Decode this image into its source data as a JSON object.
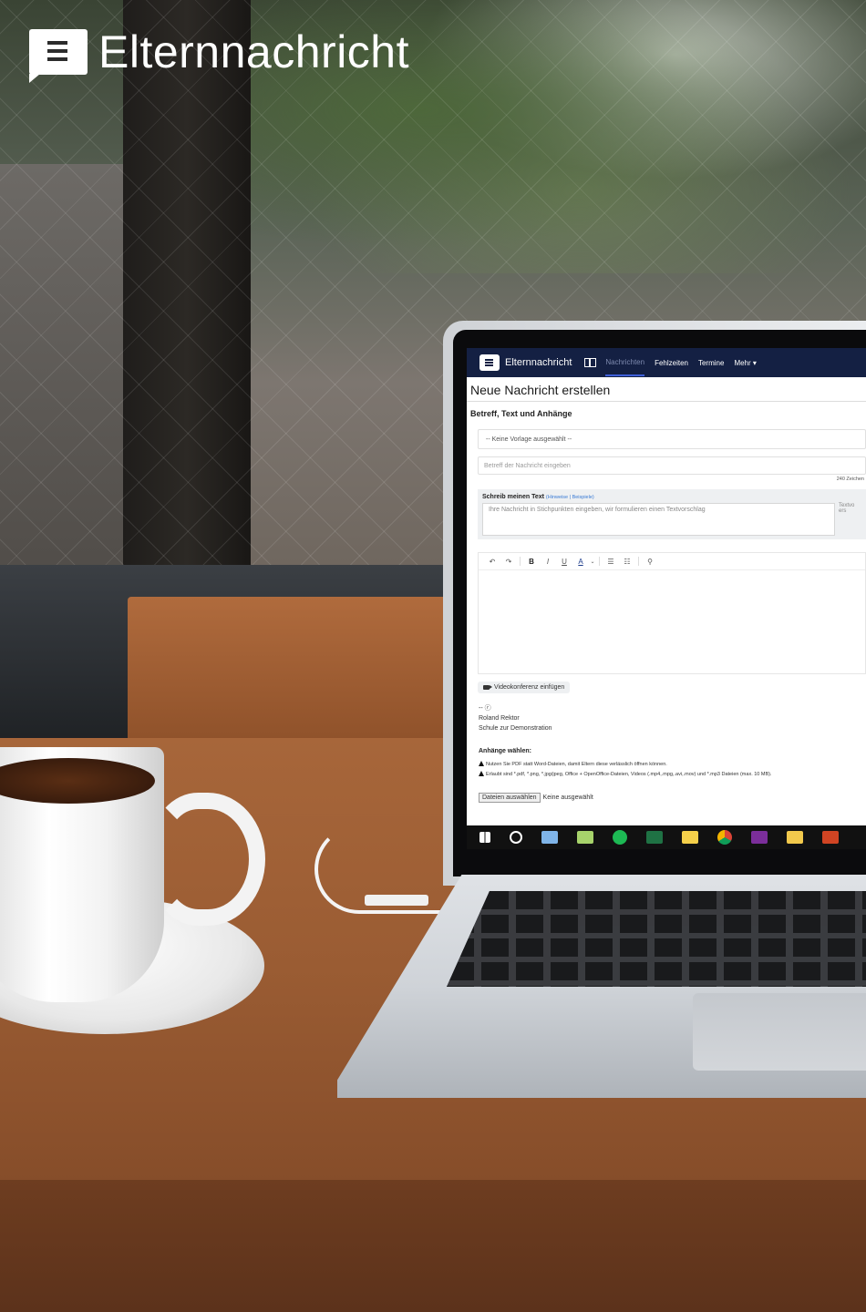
{
  "brand": {
    "name": "Elternnachricht",
    "icon": "message-bubble-icon"
  },
  "app": {
    "brand": "Elternnachricht",
    "nav": [
      {
        "label": "Nachrichten",
        "active": true
      },
      {
        "label": "Fehlzeiten"
      },
      {
        "label": "Termine"
      },
      {
        "label": "Mehr ▾"
      }
    ],
    "page_title": "Neue Nachricht erstellen",
    "section_title": "Betreff, Text und Anhänge",
    "template_select": "-- Keine Vorlage ausgewählt --",
    "subject_placeholder": "Betreff der Nachricht eingeben",
    "char_counter": "240 Zeichen",
    "ai": {
      "label": "Schreib meinen Text",
      "hint_link": "Hinweise",
      "examples_link": "Beispiele",
      "placeholder": "Ihre Nachricht in Stichpunkten eingeben, wir formulieren einen Textvorschlag",
      "side_text": "Textvo ers"
    },
    "video_button": "Videokonferenz einfügen",
    "signature": [
      "-- ⓡ",
      "Roland Rektor",
      "Schule zur Demonstration"
    ],
    "attachments": {
      "title": "Anhänge wählen:",
      "warnings": [
        "Nutzen Sie PDF statt Word-Dateien, damit Eltern diese verlässlich öffnen können.",
        "Erlaubt sind *.pdf, *.png, *.jpg/jpeg, Office + OpenOffice-Dateien, Videos (.mp4,.mpg,.avi,.mov) und *.mp3 Dateien (max. 10 MB)."
      ],
      "file_button": "Dateien auswählen",
      "file_status": "Keine ausgewählt"
    }
  },
  "colors": {
    "nav_bg": "#142043",
    "accent": "#3f5fd8"
  }
}
